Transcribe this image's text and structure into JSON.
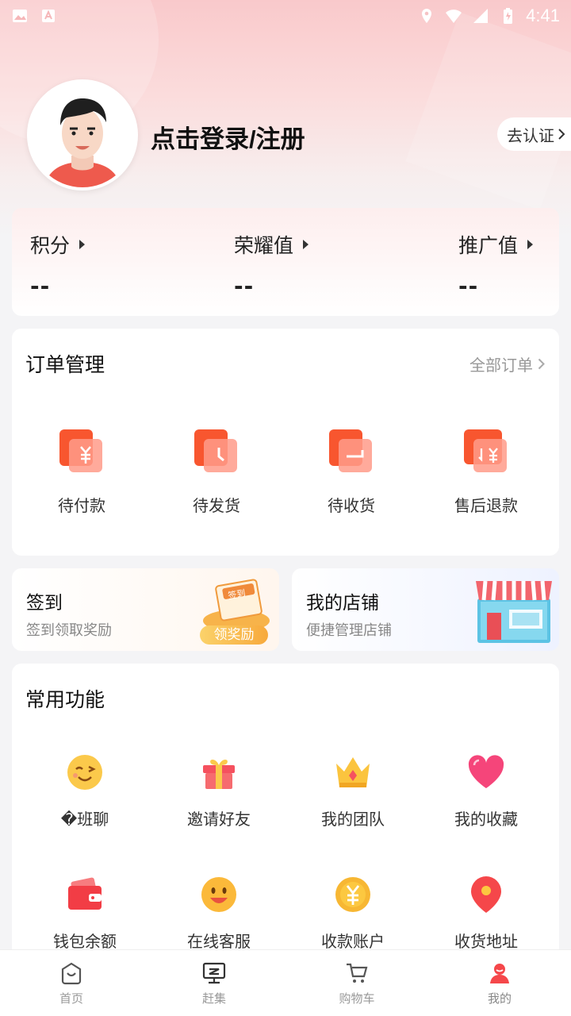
{
  "status_bar": {
    "time": "4:41"
  },
  "header": {
    "login_text": "点击登录/注册",
    "verify_label": "去认证"
  },
  "points": [
    {
      "label": "积分",
      "value": "--"
    },
    {
      "label": "荣耀值",
      "value": "--"
    },
    {
      "label": "推广值",
      "value": "--"
    }
  ],
  "orders": {
    "title": "订单管理",
    "all_label": "全部订单",
    "items": [
      {
        "label": "待付款",
        "icon": "yuan-card-icon"
      },
      {
        "label": "待发货",
        "icon": "clock-card-icon"
      },
      {
        "label": "待收货",
        "icon": "box-card-icon"
      },
      {
        "label": "售后退款",
        "icon": "refund-card-icon"
      }
    ]
  },
  "signin": {
    "title": "签到",
    "subtitle": "签到领取奖励",
    "badge": "领奖励",
    "badge_sign": "签到"
  },
  "shop": {
    "title": "我的店铺",
    "subtitle": "便捷管理店铺"
  },
  "functions": {
    "title": "常用功能",
    "items": [
      {
        "label": "�班聊",
        "icon": "wink-face-icon"
      },
      {
        "label": "邀请好友",
        "icon": "gift-icon"
      },
      {
        "label": "我的团队",
        "icon": "crown-icon"
      },
      {
        "label": "我的收藏",
        "icon": "heart-icon"
      },
      {
        "label": "钱包余额",
        "icon": "wallet-icon"
      },
      {
        "label": "在线客服",
        "icon": "smile-face-icon"
      },
      {
        "label": "收款账户",
        "icon": "yuan-coin-icon"
      },
      {
        "label": "收货地址",
        "icon": "location-pin-icon"
      }
    ]
  },
  "tabs": [
    {
      "label": "首页",
      "icon": "home-bag-icon"
    },
    {
      "label": "赶集",
      "icon": "market-icon"
    },
    {
      "label": "购物车",
      "icon": "cart-icon"
    },
    {
      "label": "我的",
      "icon": "profile-icon"
    }
  ],
  "colors": {
    "accent": "#f5474a",
    "orange": "#fa6a3c",
    "gold": "#f7b733",
    "pink": "#fde3e3"
  }
}
